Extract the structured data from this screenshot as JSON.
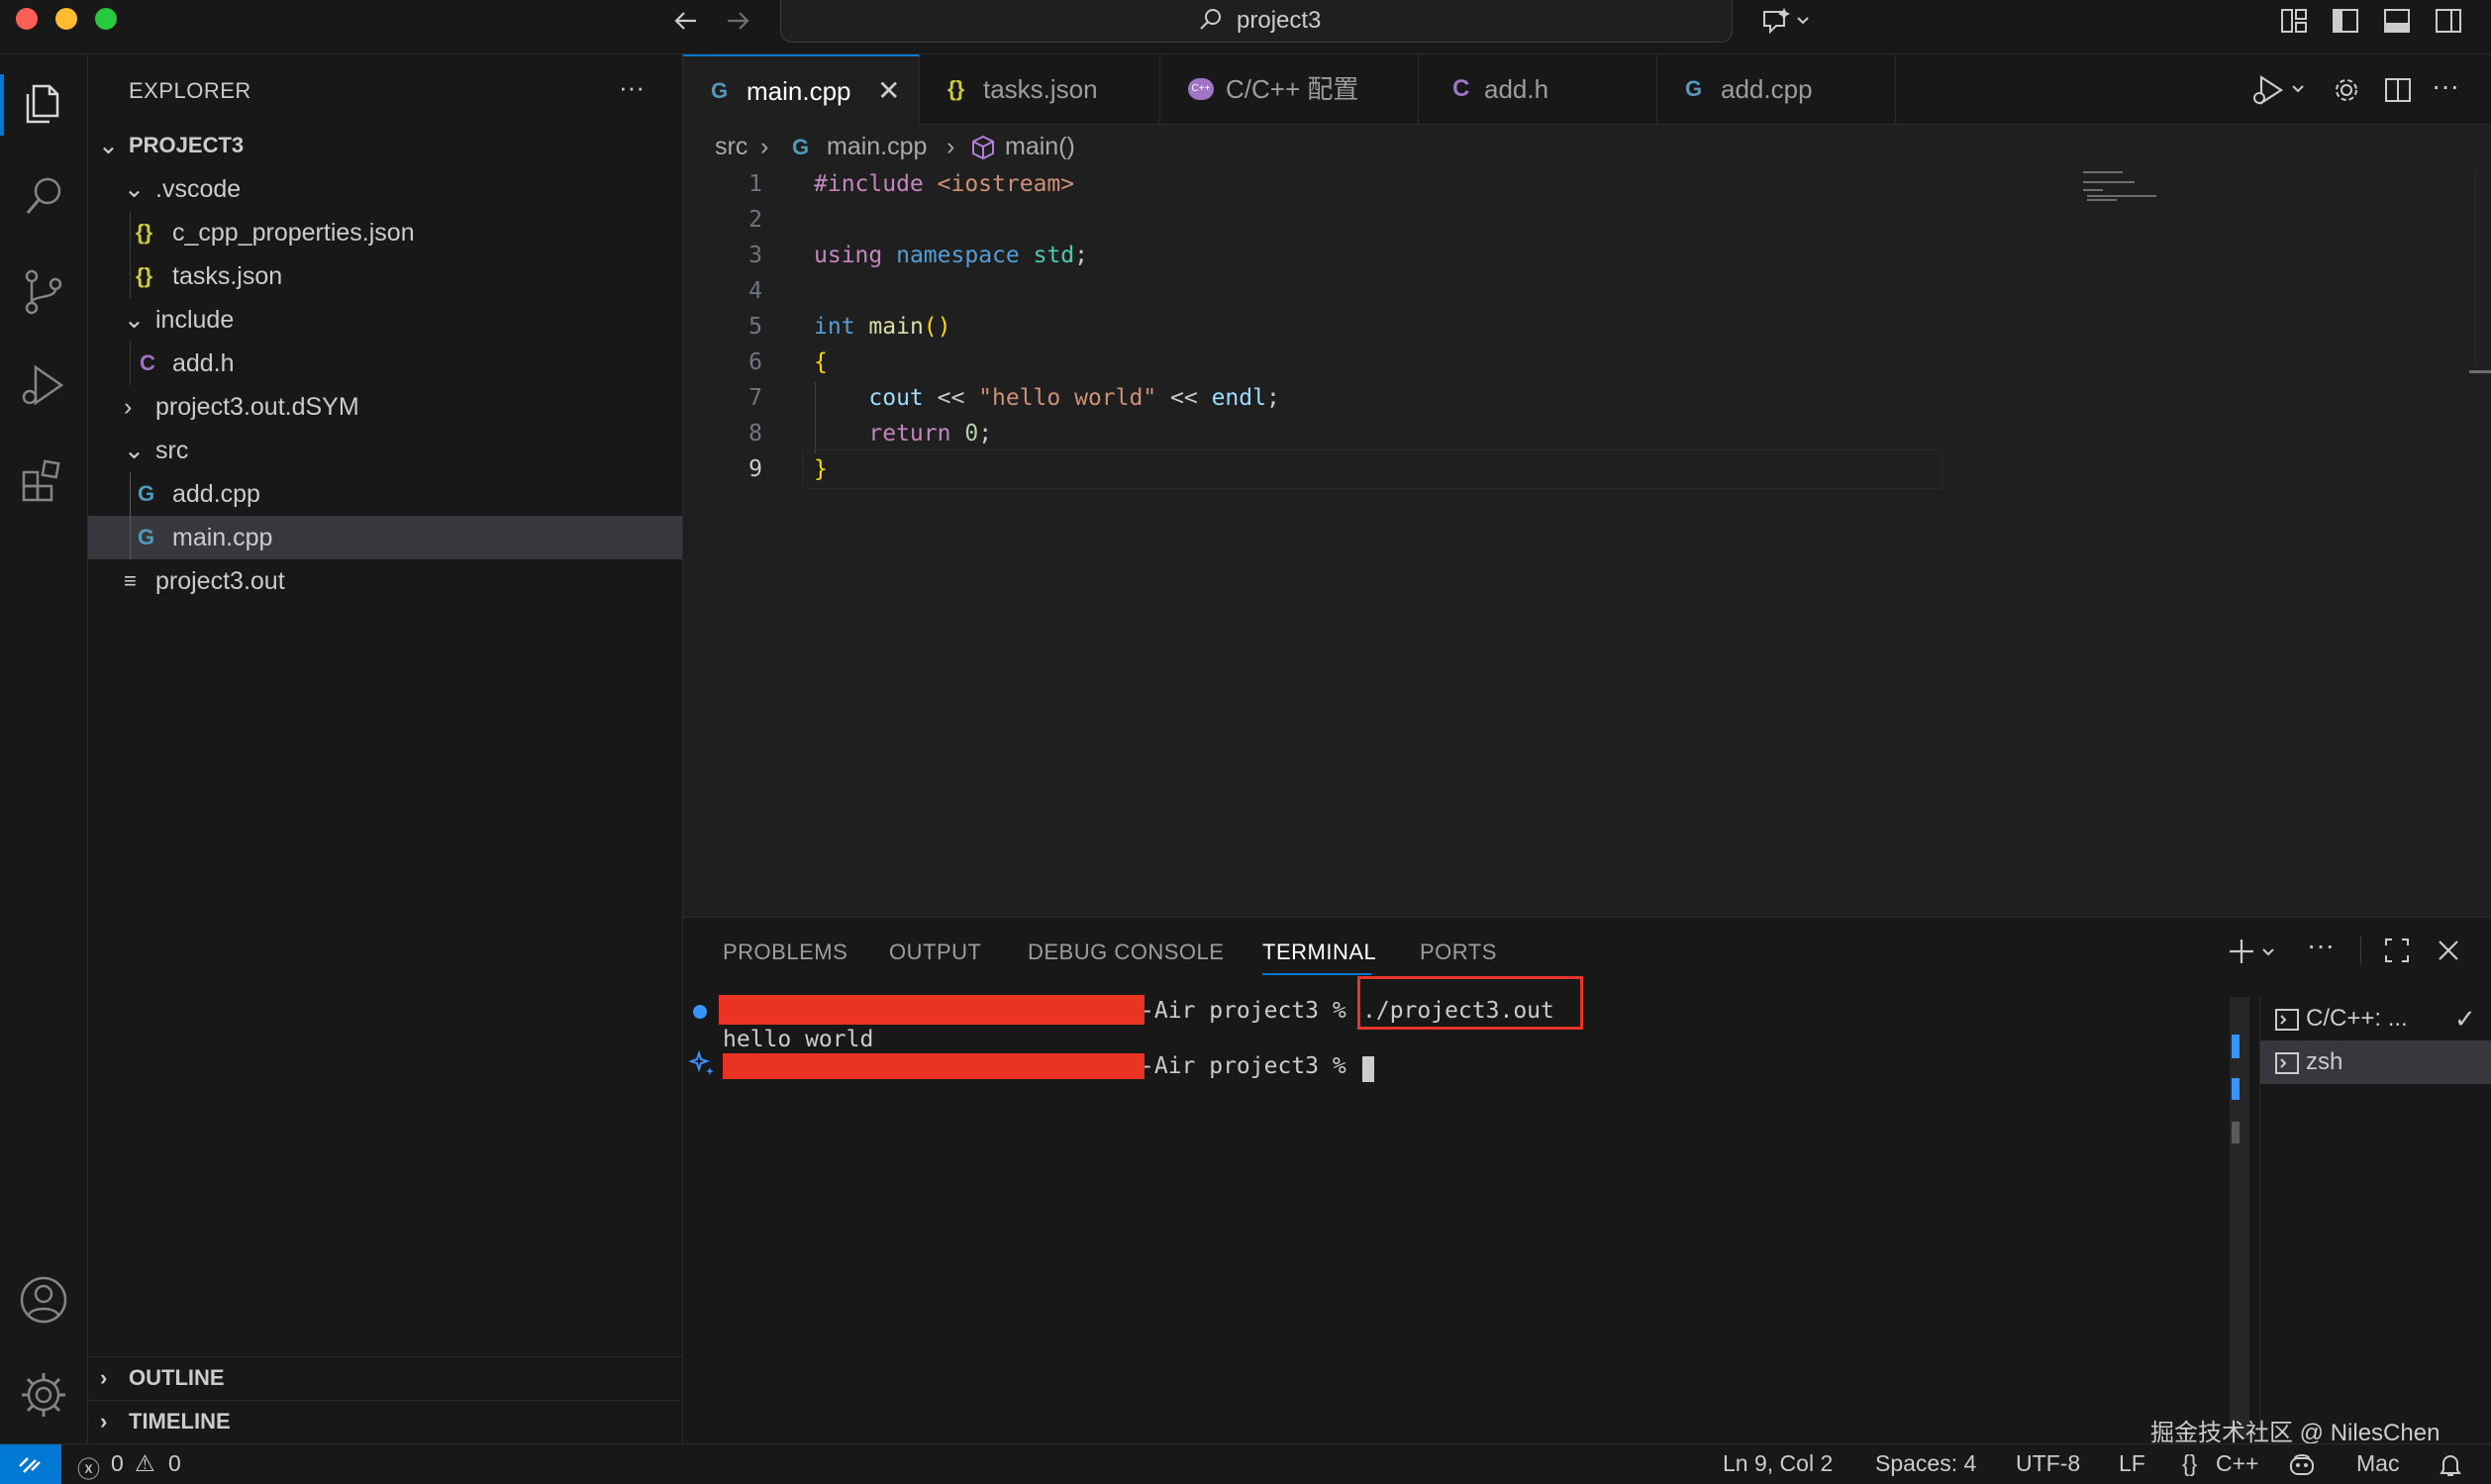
{
  "window": {
    "title": "project3"
  },
  "explorer": {
    "title": "EXPLORER",
    "project": "PROJECT3",
    "items": [
      {
        "label": ".vscode"
      },
      {
        "label": "c_cpp_properties.json",
        "icon": "{}"
      },
      {
        "label": "tasks.json",
        "icon": "{}"
      },
      {
        "label": "include"
      },
      {
        "label": "add.h",
        "icon": "C"
      },
      {
        "label": "project3.out.dSYM"
      },
      {
        "label": "src"
      },
      {
        "label": "add.cpp",
        "icon": "G"
      },
      {
        "label": "main.cpp",
        "icon": "G"
      },
      {
        "label": "project3.out",
        "icon": "≡"
      }
    ],
    "outline": "OUTLINE",
    "timeline": "TIMELINE"
  },
  "tabs": [
    {
      "label": "main.cpp",
      "icon": "G"
    },
    {
      "label": "tasks.json",
      "icon": "{}"
    },
    {
      "label": "C/C++ 配置",
      "icon": "C++"
    },
    {
      "label": "add.h",
      "icon": "C"
    },
    {
      "label": "add.cpp",
      "icon": "G"
    }
  ],
  "breadcrumb": {
    "folder": "src",
    "file": "main.cpp",
    "symbol": "main()"
  },
  "editor": {
    "line_numbers": [
      "1",
      "2",
      "3",
      "4",
      "5",
      "6",
      "7",
      "8",
      "9"
    ],
    "code": {
      "l1_directive": "#include",
      "l1_header": "<iostream>",
      "l3_using": "using",
      "l3_namespace": "namespace",
      "l3_std": "std",
      "l3_semi": ";",
      "l5_type": "int",
      "l5_fn": "main",
      "l5_parens": "()",
      "l6_open": "{",
      "l7_cout": "cout",
      "l7_op1": " << ",
      "l7_str": "\"hello world\"",
      "l7_op2": " << ",
      "l7_endl": "endl",
      "l7_semi": ";",
      "l8_return": "return",
      "l8_num": "0",
      "l8_semi": ";",
      "l9_close": "}"
    }
  },
  "panel": {
    "tabs": [
      "PROBLEMS",
      "OUTPUT",
      "DEBUG CONSOLE",
      "TERMINAL",
      "PORTS"
    ],
    "terminal": {
      "line1_suffix": "-Air project3 % ",
      "line1_cmd": "./project3.out",
      "line2": "hello world",
      "line3_suffix": "-Air project3 % "
    },
    "terminal_list": [
      {
        "label": "C/C++: ..."
      },
      {
        "label": "zsh"
      }
    ]
  },
  "watermark": "掘金技术社区 @ NilesChen",
  "statusbar": {
    "errors": "0",
    "warnings": "0",
    "position": "Ln 9, Col 2",
    "spaces": "Spaces: 4",
    "encoding": "UTF-8",
    "eol": "LF",
    "language": "C++",
    "language_icon": "{}",
    "platform": "Mac"
  },
  "colors": {
    "accent": "#0078d4",
    "redaction": "#ea3323",
    "highlight_box": "#e8352b"
  }
}
